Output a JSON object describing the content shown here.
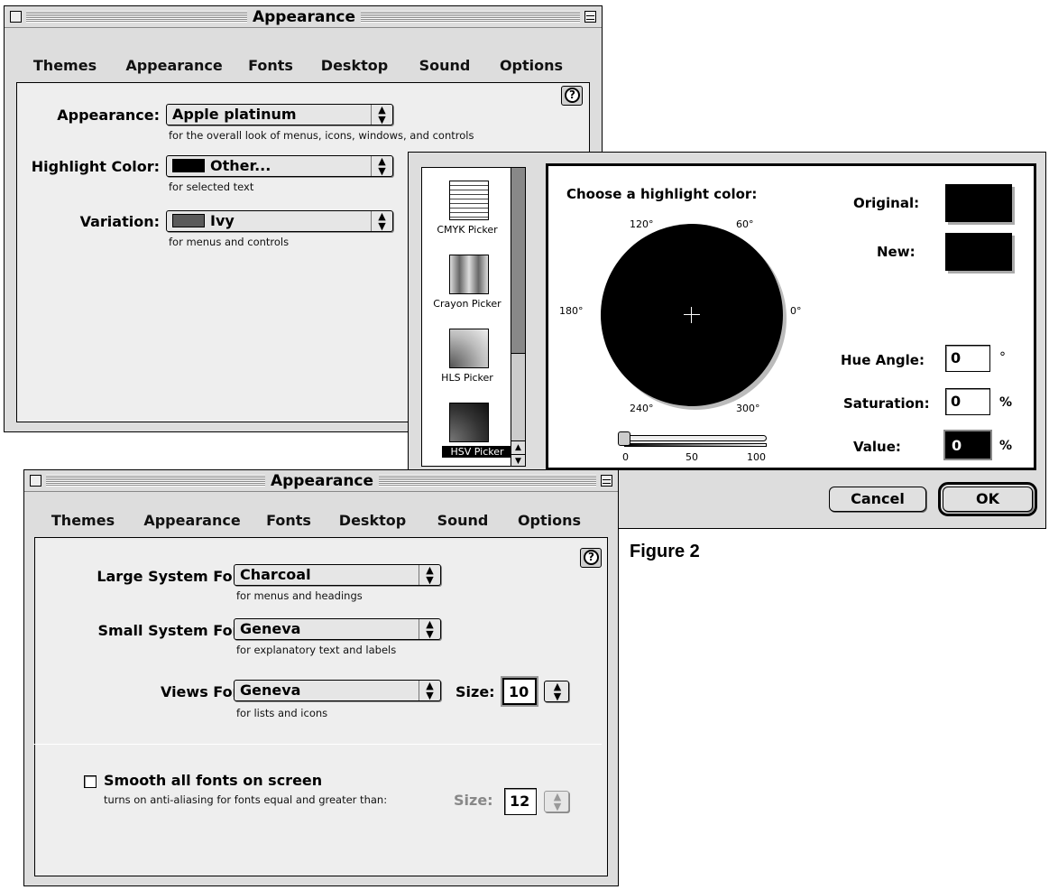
{
  "win1": {
    "title": "Appearance",
    "tabs": [
      "Themes",
      "Appearance",
      "Fonts",
      "Desktop",
      "Sound",
      "Options"
    ],
    "help": "?",
    "rows": [
      {
        "label": "Appearance:",
        "value": "Apple platinum",
        "note": "for the overall look of menus, icons, windows, and controls"
      },
      {
        "label": "Highlight Color:",
        "value": "Other...",
        "note": "for selected text",
        "swatch": "#000000"
      },
      {
        "label": "Variation:",
        "value": "Ivy",
        "note": "for menus and controls",
        "swatch": "#5a5a5a"
      }
    ]
  },
  "picker": {
    "sidebar": [
      "CMYK Picker",
      "Crayon Picker",
      "HLS Picker",
      "HSV Picker"
    ],
    "selected": "HSV Picker",
    "prompt": "Choose a highlight color:",
    "original_label": "Original:",
    "new_label": "New:",
    "wheel": {
      "a120": "120°",
      "a60": "60°",
      "a180": "180°",
      "a0": "0°",
      "a240": "240°",
      "a300": "300°"
    },
    "slider": {
      "min": "0",
      "mid": "50",
      "max": "100",
      "value": 0
    },
    "hue_label": "Hue Angle:",
    "hue_value": "0",
    "hue_unit": "°",
    "sat_label": "Saturation:",
    "sat_value": "0",
    "sat_unit": "%",
    "val_label": "Value:",
    "val_value": "0",
    "val_unit": "%",
    "cancel": "Cancel",
    "ok": "OK",
    "colors": {
      "original": "#000000",
      "new": "#000000"
    }
  },
  "figure_caption": "Figure 2",
  "win2": {
    "title": "Appearance",
    "tabs": [
      "Themes",
      "Appearance",
      "Fonts",
      "Desktop",
      "Sound",
      "Options"
    ],
    "help": "?",
    "large_label": "Large System Font:",
    "large_value": "Charcoal",
    "large_note": "for menus and headings",
    "small_label": "Small System Font:",
    "small_value": "Geneva",
    "small_note": "for explanatory text and labels",
    "views_label": "Views Font:",
    "views_value": "Geneva",
    "views_note": "for lists and icons",
    "size_label": "Size:",
    "size_value": "10",
    "smooth_label": "Smooth all fonts on screen",
    "smooth_note": "turns on anti-aliasing for fonts equal and greater than:",
    "smooth_size_label": "Size:",
    "smooth_size_value": "12"
  }
}
